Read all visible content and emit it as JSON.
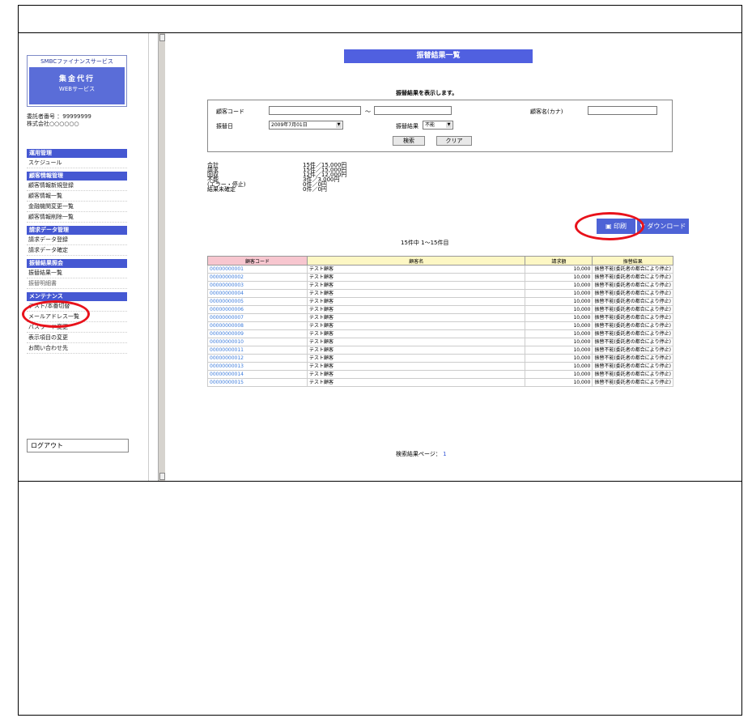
{
  "sidebar": {
    "sponsor_title": "SMBCファイナンスサービス",
    "sponsor_main": "集金代行",
    "sponsor_sub": "WEBサービス",
    "consignor_no_label": "委託者番号",
    "consignor_no": "：99999999",
    "consignor_name": "株式会社○○○○○○",
    "sections": [
      {
        "title": "運用管理",
        "items": [
          "スケジュール"
        ]
      },
      {
        "title": "顧客情報管理",
        "items": [
          "顧客情報新規登録",
          "顧客情報一覧",
          "金融機関変更一覧",
          "顧客情報削除一覧"
        ]
      },
      {
        "title": "請求データ管理",
        "items": [
          "請求データ登録",
          "請求データ確定"
        ]
      },
      {
        "title": "振替結果照会",
        "items": [
          "振替結果一覧",
          "振替明細書"
        ]
      },
      {
        "title": "メンテナンス",
        "items": [
          "テスト/本番切替",
          "メールアドレス一覧",
          "パスワード変更",
          "表示項目の変更",
          "お問い合わせ先"
        ]
      }
    ],
    "logout": "ログアウト"
  },
  "main": {
    "page_title": "振替結果一覧",
    "subtitle": "振替結果を表示します。",
    "search": {
      "customer_code_label": "顧客コード",
      "customer_code_from": "",
      "range_sep": "～",
      "customer_code_to": "",
      "customer_kana_label": "顧客名(カナ)",
      "customer_kana": "",
      "transfer_date_label": "振替日",
      "transfer_date": "2009年7月01日",
      "result_label": "振替結果",
      "result_value": "不能",
      "search_button": "検索",
      "clear_button": "クリア"
    },
    "summary": [
      {
        "label": "合計",
        "value": "15件／15,000円"
      },
      {
        "label": "請求",
        "value": "15件／15,000円"
      },
      {
        "label": "回収",
        "value": "12件／12,000円"
      },
      {
        "label": "不能",
        "value": "3件／3,000円"
      },
      {
        "label": "(エラー・停止)",
        "value": "0件／0円"
      },
      {
        "label": "結果未確定",
        "value": "0件／0円"
      }
    ],
    "print_button": "印刷",
    "download_button": "ダウンロード",
    "result_count": "15件中 1～15件目",
    "table": {
      "headers": [
        "顧客コード",
        "顧客名",
        "請求額",
        "振替結果"
      ],
      "rows": [
        {
          "code": "00000000001",
          "name": "テスト顧客",
          "amount": "10,000",
          "result": "振替不能(委託者の都合により停止)"
        },
        {
          "code": "00000000002",
          "name": "テスト顧客",
          "amount": "10,000",
          "result": "振替不能(委託者の都合により停止)"
        },
        {
          "code": "00000000003",
          "name": "テスト顧客",
          "amount": "10,000",
          "result": "振替不能(委託者の都合により停止)"
        },
        {
          "code": "00000000004",
          "name": "テスト顧客",
          "amount": "10,000",
          "result": "振替不能(委託者の都合により停止)"
        },
        {
          "code": "00000000005",
          "name": "テスト顧客",
          "amount": "10,000",
          "result": "振替不能(委託者の都合により停止)"
        },
        {
          "code": "00000000006",
          "name": "テスト顧客",
          "amount": "10,000",
          "result": "振替不能(委託者の都合により停止)"
        },
        {
          "code": "00000000007",
          "name": "テスト顧客",
          "amount": "10,000",
          "result": "振替不能(委託者の都合により停止)"
        },
        {
          "code": "00000000008",
          "name": "テスト顧客",
          "amount": "10,000",
          "result": "振替不能(委託者の都合により停止)"
        },
        {
          "code": "00000000009",
          "name": "テスト顧客",
          "amount": "10,000",
          "result": "振替不能(委託者の都合により停止)"
        },
        {
          "code": "00000000010",
          "name": "テスト顧客",
          "amount": "10,000",
          "result": "振替不能(委託者の都合により停止)"
        },
        {
          "code": "00000000011",
          "name": "テスト顧客",
          "amount": "10,000",
          "result": "振替不能(委託者の都合により停止)"
        },
        {
          "code": "00000000012",
          "name": "テスト顧客",
          "amount": "10,000",
          "result": "振替不能(委託者の都合により停止)"
        },
        {
          "code": "00000000013",
          "name": "テスト顧客",
          "amount": "10,000",
          "result": "振替不能(委託者の都合により停止)"
        },
        {
          "code": "00000000014",
          "name": "テスト顧客",
          "amount": "10,000",
          "result": "振替不能(委託者の都合により停止)"
        },
        {
          "code": "00000000015",
          "name": "テスト顧客",
          "amount": "10,000",
          "result": "振替不能(委託者の都合により停止)"
        }
      ]
    },
    "pager": "検索結果ページ：",
    "pager_page": "1"
  },
  "colors": {
    "menu_header": "#4558d2",
    "title_band": "#5060e0",
    "highlight": "#e8121b",
    "link": "#3b7bdc",
    "header_pink": "#f7c6cf",
    "header_yellow": "#fdf7c4"
  }
}
